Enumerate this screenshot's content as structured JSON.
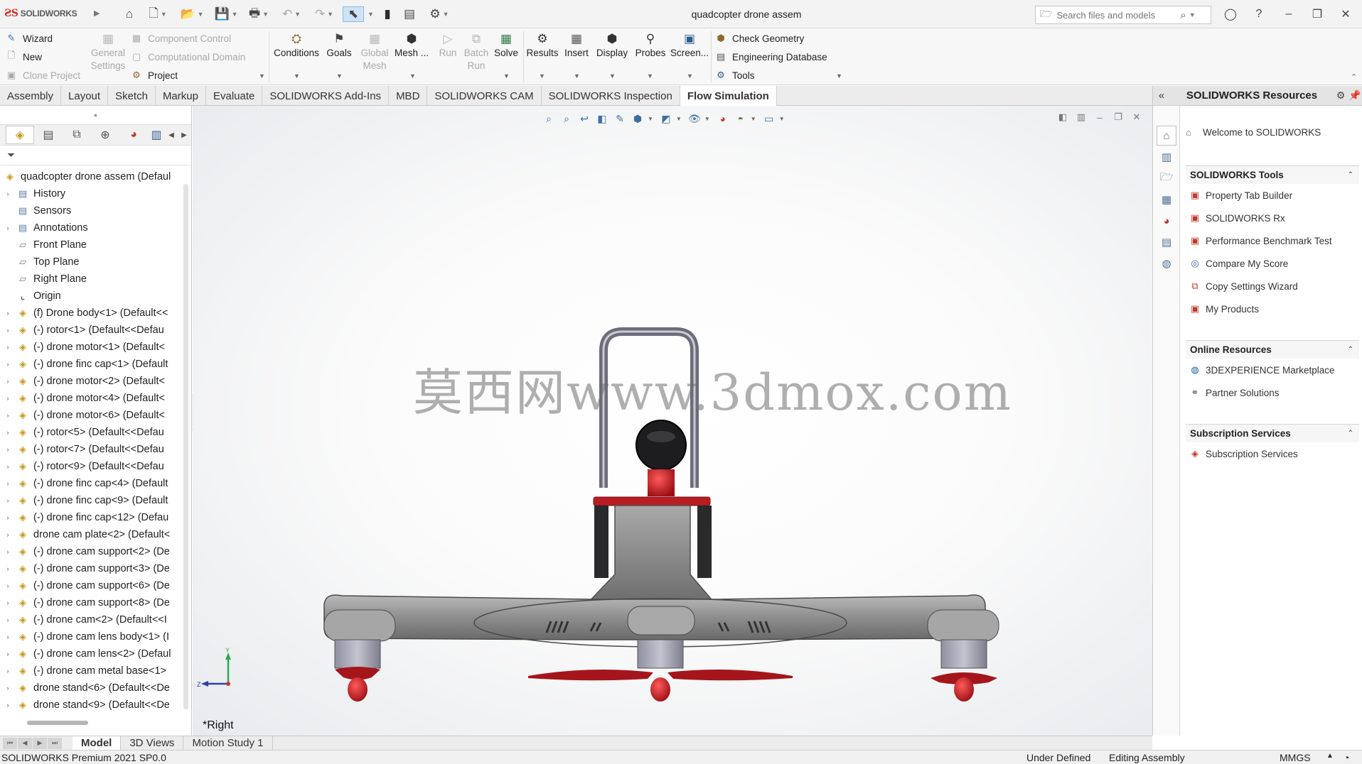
{
  "app": {
    "brand": "SOLIDWORKS",
    "document_title": "quadcopter drone assem",
    "search_placeholder": "Search files and models"
  },
  "command_manager": {
    "col1": [
      "Wizard",
      "New",
      "Clone Project"
    ],
    "col2": [
      "General Settings"
    ],
    "col3": [
      "Component Control",
      "Computational Domain",
      "Project"
    ],
    "big_buttons": [
      "Conditions",
      "Goals",
      "Global Mesh",
      "Mesh ...",
      "Run",
      "Batch Run",
      "Solve",
      "Results",
      "Insert",
      "Display",
      "Probes",
      "Screen..."
    ],
    "col_right": [
      "Check Geometry",
      "Engineering Database",
      "Tools"
    ]
  },
  "tabs": [
    "Assembly",
    "Layout",
    "Sketch",
    "Markup",
    "Evaluate",
    "SOLIDWORKS Add-Ins",
    "MBD",
    "SOLIDWORKS CAM",
    "SOLIDWORKS Inspection",
    "Flow Simulation"
  ],
  "active_tab": "Flow Simulation",
  "feature_tree": {
    "root": "quadcopter drone assem  (Defaul",
    "items": [
      {
        "label": "History",
        "icon": "folder",
        "expand": true
      },
      {
        "label": "Sensors",
        "icon": "folder",
        "expand": false
      },
      {
        "label": "Annotations",
        "icon": "folder",
        "expand": true
      },
      {
        "label": "Front Plane",
        "icon": "plane",
        "expand": false
      },
      {
        "label": "Top Plane",
        "icon": "plane",
        "expand": false
      },
      {
        "label": "Right Plane",
        "icon": "plane",
        "expand": false
      },
      {
        "label": "Origin",
        "icon": "origin",
        "expand": false
      },
      {
        "label": "(f) Drone body<1> (Default<<",
        "icon": "asm",
        "expand": true
      },
      {
        "label": "(-) rotor<1> (Default<<Defau",
        "icon": "asm",
        "expand": true
      },
      {
        "label": "(-) drone motor<1> (Default<",
        "icon": "asm",
        "expand": true
      },
      {
        "label": "(-) drone finc cap<1> (Default",
        "icon": "asm",
        "expand": true
      },
      {
        "label": "(-) drone motor<2> (Default<",
        "icon": "asm",
        "expand": true
      },
      {
        "label": "(-) drone motor<4> (Default<",
        "icon": "asm",
        "expand": true
      },
      {
        "label": "(-) drone motor<6> (Default<",
        "icon": "asm",
        "expand": true
      },
      {
        "label": "(-) rotor<5> (Default<<Defau",
        "icon": "asm",
        "expand": true
      },
      {
        "label": "(-) rotor<7> (Default<<Defau",
        "icon": "asm",
        "expand": true
      },
      {
        "label": "(-) rotor<9> (Default<<Defau",
        "icon": "asm",
        "expand": true
      },
      {
        "label": "(-) drone finc cap<4> (Default",
        "icon": "asm",
        "expand": true
      },
      {
        "label": "(-) drone finc cap<9> (Default",
        "icon": "asm",
        "expand": true
      },
      {
        "label": "(-) drone finc cap<12> (Defau",
        "icon": "asm",
        "expand": true
      },
      {
        "label": "drone cam plate<2> (Default<",
        "icon": "asm",
        "expand": true
      },
      {
        "label": "(-) drone cam support<2> (De",
        "icon": "asm",
        "expand": true
      },
      {
        "label": "(-) drone cam support<3> (De",
        "icon": "asm",
        "expand": true
      },
      {
        "label": "(-) drone cam support<6> (De",
        "icon": "asm",
        "expand": true
      },
      {
        "label": "(-) drone cam support<8> (De",
        "icon": "asm",
        "expand": true
      },
      {
        "label": "(-) drone cam<2> (Default<<I",
        "icon": "asm",
        "expand": true
      },
      {
        "label": "(-) drone cam lens body<1> (I",
        "icon": "asm",
        "expand": true
      },
      {
        "label": "(-) drone cam lens<2> (Defaul",
        "icon": "asm",
        "expand": true
      },
      {
        "label": "(-) drone cam metal base<1>",
        "icon": "asm",
        "expand": true
      },
      {
        "label": "drone stand<6> (Default<<De",
        "icon": "asm",
        "expand": true
      },
      {
        "label": "drone stand<9> (Default<<De",
        "icon": "asm",
        "expand": true
      }
    ]
  },
  "viewport": {
    "watermark": "莫西网www.3dmox.com",
    "view_label": "*Right",
    "triad_y": "Y",
    "triad_z": "Z"
  },
  "task_pane": {
    "title": "SOLIDWORKS Resources",
    "welcome": "Welcome to SOLIDWORKS",
    "sections": [
      {
        "title": "SOLIDWORKS Tools",
        "items": [
          "Property Tab Builder",
          "SOLIDWORKS Rx",
          "Performance Benchmark Test",
          "Compare My Score",
          "Copy Settings Wizard",
          "My Products"
        ]
      },
      {
        "title": "Online Resources",
        "items": [
          "3DEXPERIENCE Marketplace",
          "Partner Solutions"
        ]
      },
      {
        "title": "Subscription Services",
        "items": [
          "Subscription Services"
        ]
      }
    ]
  },
  "bottom_tabs": [
    "Model",
    "3D Views",
    "Motion Study 1"
  ],
  "active_bottom_tab": "Model",
  "status": {
    "product": "SOLIDWORKS Premium 2021 SP0.0",
    "definition": "Under Defined",
    "mode": "Editing Assembly",
    "units": "MMGS"
  },
  "colors": {
    "brand_red": "#d12b23",
    "rotor_red": "#b81e24",
    "body_gray": "#8f8f8f"
  }
}
